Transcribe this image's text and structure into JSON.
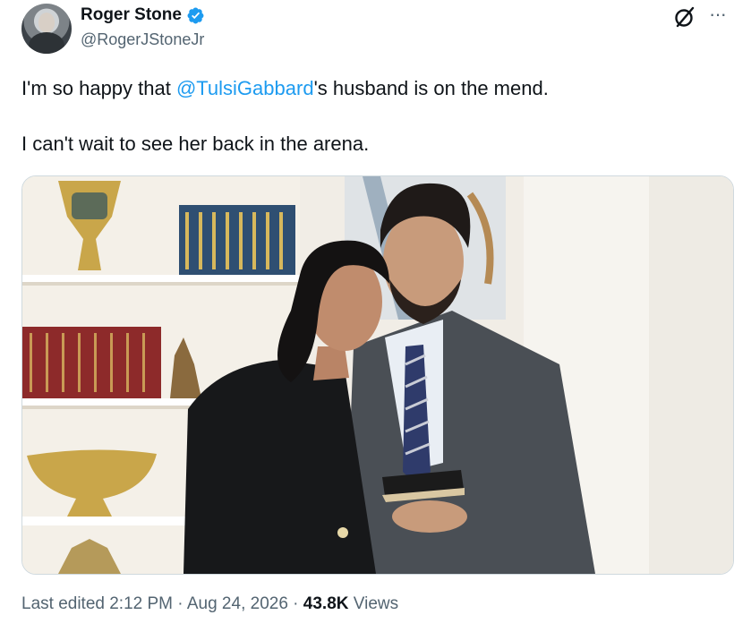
{
  "author": {
    "display_name": "Roger Stone",
    "handle": "@RogerJStoneJr",
    "verified": true,
    "avatar_icon": "avatar-photo"
  },
  "header_icons": [
    "grok-icon",
    "more-options-icon"
  ],
  "more_glyph": "···",
  "tweet": {
    "line1_before": "I'm so happy that ",
    "mention": "@TulsiGabbard",
    "line1_after": "'s husband is on the mend.",
    "line2": "I can't wait to see her back in the arena."
  },
  "media": {
    "type": "photo",
    "icon": "tweet-photo"
  },
  "footer": {
    "edited_label": "Last edited 2:12 PM",
    "separator": " · ",
    "date": "Aug 24, 2026",
    "views_count": "43.8K",
    "views_label": " Views"
  },
  "colors": {
    "accent": "#1d9bf0",
    "text": "#0f1419",
    "secondary": "#536471",
    "border": "#cfd9de"
  }
}
